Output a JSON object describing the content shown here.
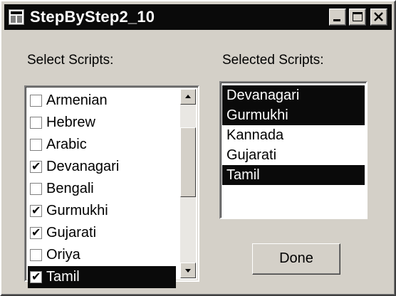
{
  "window": {
    "title": "StepByStep2_10"
  },
  "labels": {
    "select": "Select Scripts:",
    "selected": "Selected Scripts:"
  },
  "scripts": [
    {
      "label": "Armenian",
      "checked": false,
      "highlighted": false
    },
    {
      "label": "Hebrew",
      "checked": false,
      "highlighted": false
    },
    {
      "label": "Arabic",
      "checked": false,
      "highlighted": false
    },
    {
      "label": "Devanagari",
      "checked": true,
      "highlighted": false
    },
    {
      "label": "Bengali",
      "checked": false,
      "highlighted": false
    },
    {
      "label": "Gurmukhi",
      "checked": true,
      "highlighted": false
    },
    {
      "label": "Gujarati",
      "checked": true,
      "highlighted": false
    },
    {
      "label": "Oriya",
      "checked": false,
      "highlighted": false
    },
    {
      "label": "Tamil",
      "checked": true,
      "highlighted": true
    }
  ],
  "selected_scripts": [
    {
      "label": "Devanagari",
      "highlighted": true
    },
    {
      "label": "Gurmukhi",
      "highlighted": true
    },
    {
      "label": "Kannada",
      "highlighted": false
    },
    {
      "label": "Gujarati",
      "highlighted": false
    },
    {
      "label": "Tamil",
      "highlighted": true
    }
  ],
  "done_button": "Done",
  "icons": {
    "app": "app-window-icon",
    "minimize": "minimize-icon",
    "maximize": "maximize-icon",
    "close": "close-icon",
    "scroll_up": "arrow-up-icon",
    "scroll_down": "arrow-down-icon"
  },
  "colors": {
    "dialog_bg": "#d4d0c8",
    "highlight": "#0a0a0a",
    "titlebar": "#0a0a0a"
  }
}
